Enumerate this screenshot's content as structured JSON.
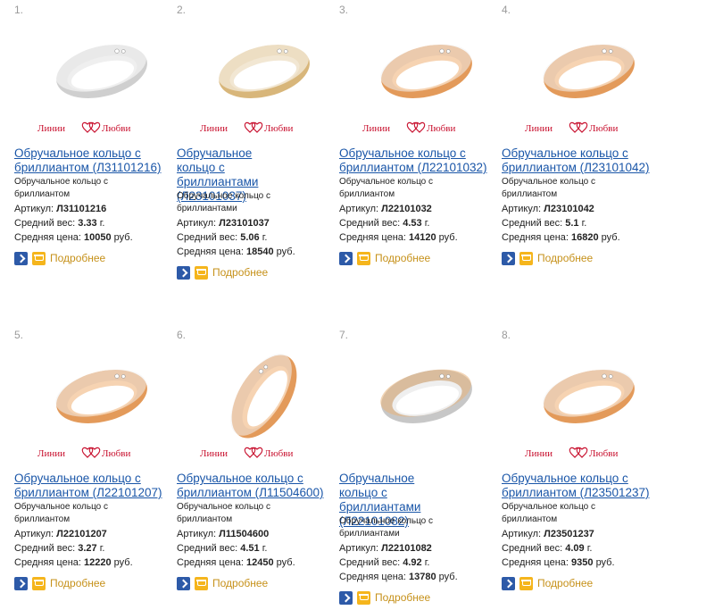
{
  "brand_logo_text": "Линии Любви",
  "labels": {
    "article": "Артикул:",
    "weight": "Средний вес:",
    "price": "Средняя цена:",
    "more": "Подробнее",
    "units_g": "г.",
    "units_rub": "руб."
  },
  "products": [
    {
      "num": "1.",
      "title": "Обручальное кольцо с бриллиантом (Л31101216)",
      "desc": "Обручальное кольцо с бриллиантом",
      "article": "Л31101216",
      "weight": "3.33",
      "price": "10050",
      "has_logo": true
    },
    {
      "num": "2.",
      "title": "Обручальное кольцо с бриллиантами (Л23101037)",
      "desc": "Обручальное кольцо с бриллиантами",
      "article": "Л23101037",
      "weight": "5.06",
      "price": "18540",
      "has_logo": true
    },
    {
      "num": "3.",
      "title": "Обручальное кольцо с бриллиантом (Л22101032)",
      "desc": "Обручальное кольцо с бриллиантом",
      "article": "Л22101032",
      "weight": "4.53",
      "price": "14120",
      "has_logo": true
    },
    {
      "num": "4.",
      "title": "Обручальное кольцо с бриллиантом (Л23101042)",
      "desc": "Обручальное кольцо с бриллиантом",
      "article": "Л23101042",
      "weight": "5.1",
      "price": "16820",
      "has_logo": true
    },
    {
      "num": "5.",
      "title": "Обручальное кольцо с бриллиантом (Л22101207)",
      "desc": "Обручальное кольцо с бриллиантом",
      "article": "Л22101207",
      "weight": "3.27",
      "price": "12220",
      "has_logo": true
    },
    {
      "num": "6.",
      "title": "Обручальное кольцо с бриллиантом (Л11504600)",
      "desc": "Обручальное кольцо с бриллиантом",
      "article": "Л11504600",
      "weight": "4.51",
      "price": "12450",
      "has_logo": true
    },
    {
      "num": "7.",
      "title": "Обручальное кольцо с бриллиантами (Л22101082)",
      "desc": "Обручальное кольцо с бриллиантами",
      "article": "Л22101082",
      "weight": "4.92",
      "price": "13780",
      "has_logo": false
    },
    {
      "num": "8.",
      "title": "Обручальное кольцо с бриллиантом (Л23501237)",
      "desc": "Обручальное кольцо с бриллиантом",
      "article": "Л23501237",
      "weight": "4.09",
      "price": "9350",
      "has_logo": true
    }
  ],
  "colors": {
    "link": "#1a56a8",
    "more": "#c6911a",
    "number": "#9a9a9a",
    "logo_red": "#c8102e",
    "gold": "#e39a5a",
    "white_gold": "#d8d8d8"
  },
  "icons": [
    "arrow-right-icon",
    "cart-icon",
    "heart-icon"
  ]
}
